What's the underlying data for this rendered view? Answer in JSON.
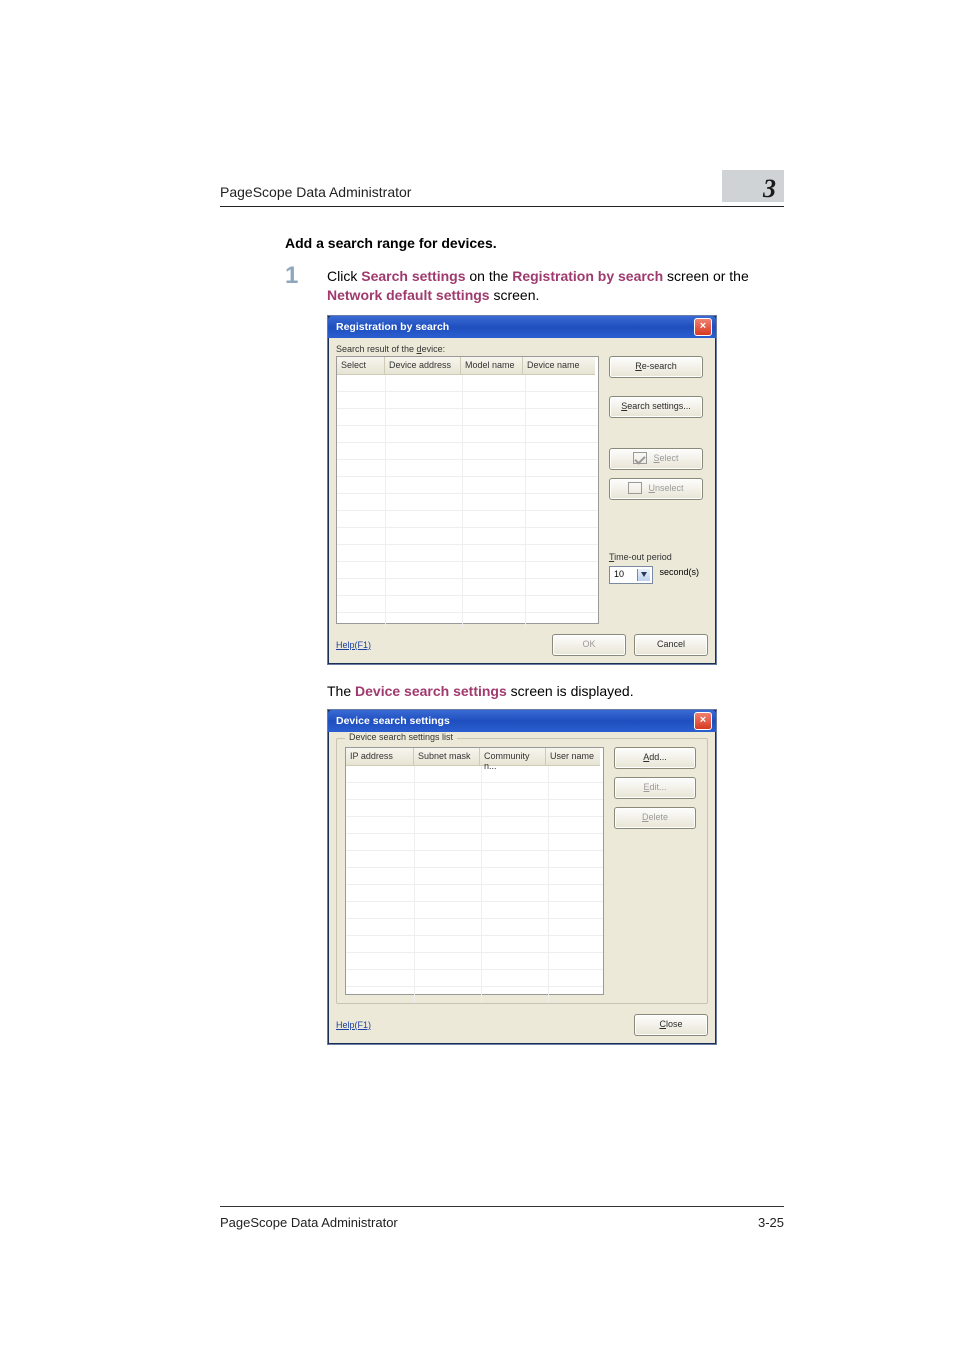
{
  "runner": "PageScope Data Administrator",
  "chapter_mark": "3",
  "heading": "Add a search range for devices.",
  "step1": {
    "num": "1",
    "pre": "Click ",
    "kw1": "Search settings",
    "mid1": " on the ",
    "kw2": "Registration by search",
    "mid2": " screen or the ",
    "kw3": "Network default settings",
    "post": " screen."
  },
  "dialog1": {
    "title": "Registration by search",
    "search_label": "Search result of the device:",
    "search_label_ul": "d",
    "cols": [
      "Select",
      "Device address",
      "Model name",
      "Device name"
    ],
    "buttons": {
      "research_pre": "R",
      "research_rest": "e-search",
      "search_settings_pre": "S",
      "search_settings_rest": "earch settings...",
      "select_pre": "S",
      "select_rest": "elect",
      "unselect_pre": "U",
      "unselect_rest": "nselect"
    },
    "timeout_label_pre": "T",
    "timeout_label_rest": "ime-out period",
    "timeout_value": "10",
    "timeout_unit": "second(s)",
    "help": "Help(F1)",
    "ok": "OK",
    "cancel": "Cancel"
  },
  "intertext_pre": "The ",
  "intertext_kw": "Device search settings",
  "intertext_post": " screen is displayed.",
  "dialog2": {
    "title": "Device search settings",
    "group": "Device search settings list",
    "cols": [
      "IP address",
      "Subnet mask",
      "Community n...",
      "User name"
    ],
    "buttons": {
      "add_pre": "A",
      "add_rest": "dd...",
      "edit_pre": "E",
      "edit_rest": "dit...",
      "delete_pre": "D",
      "delete_rest": "elete"
    },
    "help": "Help(F1)",
    "close_pre": "C",
    "close_rest": "lose"
  },
  "footer_left": "PageScope Data Administrator",
  "footer_right": "3-25"
}
